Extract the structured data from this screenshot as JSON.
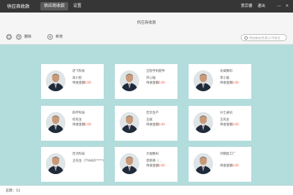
{
  "topbar": {
    "app_title": "供应商收款",
    "tabs": [
      {
        "label": "供应商收款",
        "active": true
      },
      {
        "label": "设置",
        "active": false
      }
    ],
    "user_name": "贾宗德",
    "logout_label": "退出",
    "minimize_glyph": "—",
    "close_glyph": "✕"
  },
  "page": {
    "title": "供应商收款"
  },
  "toolbar": {
    "delete_label": "删除",
    "add_label": "新增",
    "search_placeholder": "供应商名/负责人/手机号"
  },
  "cards": [
    {
      "company": "虎飞科技",
      "contact": "高小航",
      "amount_label": "待收金额：",
      "amount": "0.00"
    },
    {
      "company": "全程手机配件",
      "contact": "开心陆",
      "amount_label": "待收金额：",
      "amount": "0.00"
    },
    {
      "company": "龙威数码",
      "contact": "李小猫",
      "amount_label": "待收金额：",
      "amount": "0.00"
    },
    {
      "company": "四环科技",
      "contact": "何先生",
      "amount_label": "待收金额：",
      "amount": "0.00"
    },
    {
      "company": "佳华生产",
      "contact": "王斌",
      "amount_label": "待收金额：",
      "amount": "0.00"
    },
    {
      "company": "兴士通讯",
      "contact": "王先生",
      "amount_label": "待收金额：",
      "amount": "0.00"
    },
    {
      "company": "佳鸿科技",
      "contact": "王先生（TYA82F****）",
      "amount_label": "",
      "amount": ""
    },
    {
      "company": "大福数码",
      "contact": "李艳艳（...",
      "amount_label": "待收金额：",
      "amount": "0.00"
    },
    {
      "company": "鸿锦屋工厂",
      "contact": "",
      "amount_label": "待收金额：",
      "amount": "0.00"
    }
  ],
  "footer": {
    "total_text": "总数：11"
  },
  "colors": {
    "topbar": "#363636",
    "content_bg": "#b3dcdc",
    "amount": "#e05a3a"
  }
}
